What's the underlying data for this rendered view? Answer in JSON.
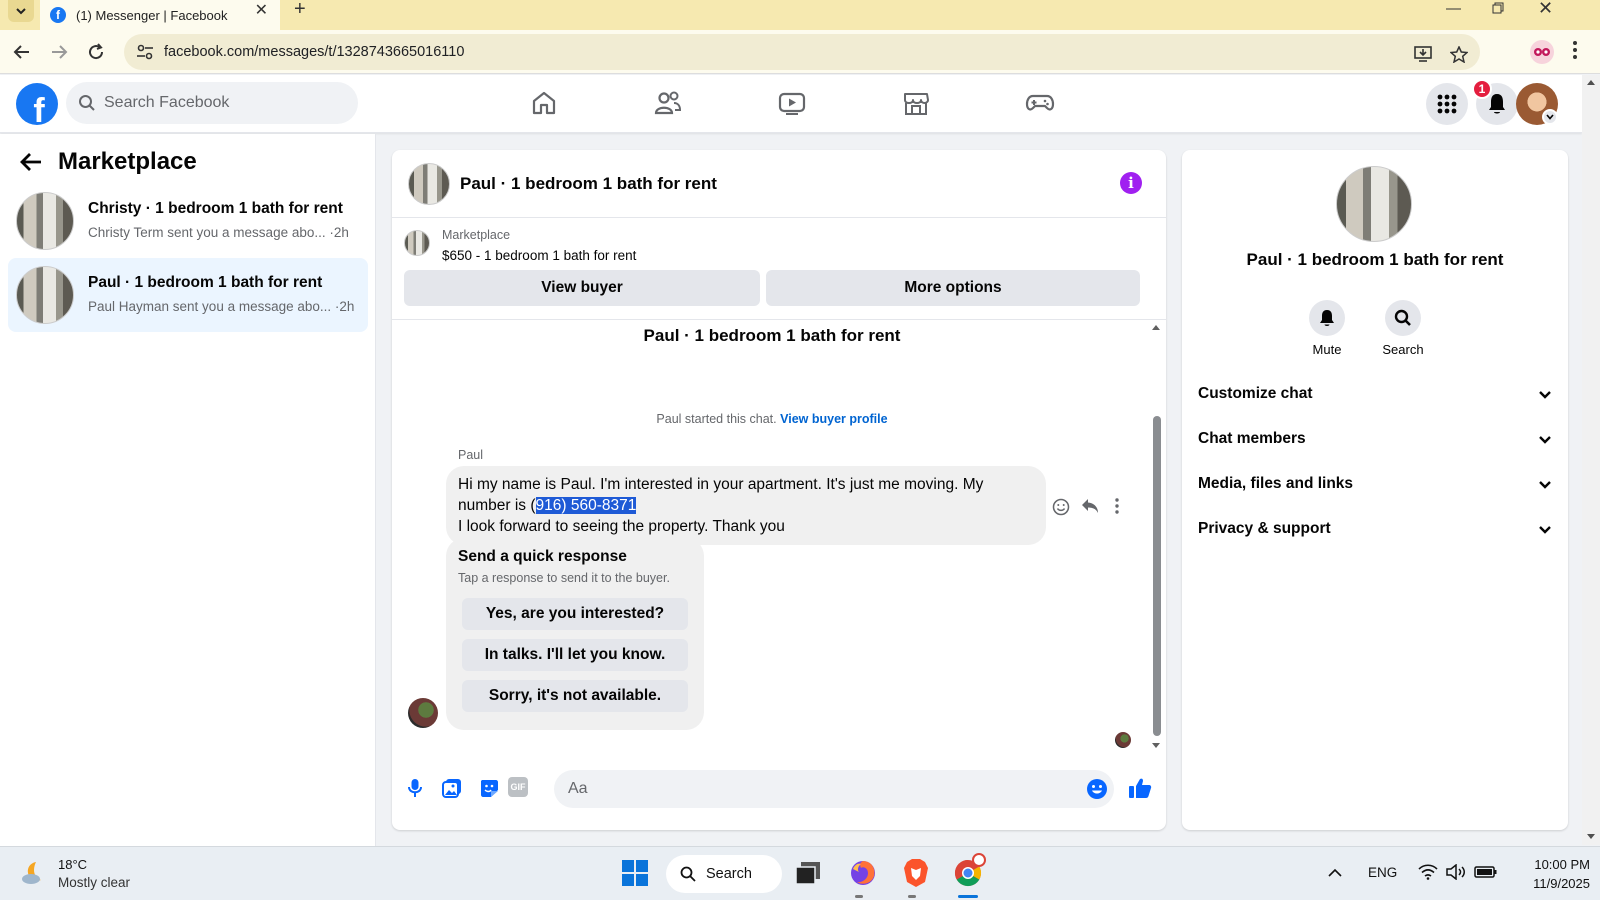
{
  "browser": {
    "tab_title": "(1) Messenger | Facebook",
    "url": "facebook.com/messages/t/1328743665016110"
  },
  "header": {
    "search_placeholder": "Search Facebook",
    "notification_count": "1"
  },
  "left": {
    "title": "Marketplace",
    "conversations": [
      {
        "title": "Christy · 1 bedroom 1 bath for rent",
        "preview": "Christy Term sent you a message abo... ·2h",
        "active": false
      },
      {
        "title": "Paul · 1 bedroom 1 bath for rent",
        "preview": "Paul Hayman sent you a message abo... ·2h",
        "active": true
      }
    ]
  },
  "chat": {
    "header_title": "Paul · 1 bedroom 1 bath for rent",
    "listing_category": "Marketplace",
    "listing_price": "$650 - 1 bedroom 1 bath for rent",
    "view_buyer_label": "View buyer",
    "more_options_label": "More options",
    "thread_title": "Paul · 1 bedroom 1 bath for rent",
    "started_text": "Paul started this chat.",
    "view_buyer_profile_label": "View buyer profile",
    "sender_name": "Paul",
    "message_part1": "Hi my name is Paul. I'm interested in your apartment. It's just me moving. My number is (",
    "message_highlight": "916) 560-8371",
    "message_part2": "I look forward to seeing the property. Thank you",
    "quick_response_title": "Send a quick response",
    "quick_response_subtitle": "Tap a response to send it to the buyer.",
    "quick_responses": [
      "Yes, are you interested?",
      "In talks. I'll let you know.",
      "Sorry, it's not available."
    ],
    "composer_placeholder": "Aa"
  },
  "right": {
    "name": "Paul · 1 bedroom 1 bath for rent",
    "mute_label": "Mute",
    "search_label": "Search",
    "sections": [
      "Customize chat",
      "Chat members",
      "Media, files and links",
      "Privacy & support"
    ]
  },
  "taskbar": {
    "temperature": "18°C",
    "condition": "Mostly clear",
    "search_label": "Search",
    "language": "ENG",
    "time": "10:00 PM",
    "date": "11/9/2025"
  },
  "colors": {
    "fb_blue": "#1877f2",
    "info_purple": "#a020f0",
    "link_blue": "#0064d1",
    "notification_red": "#e41e3f"
  }
}
